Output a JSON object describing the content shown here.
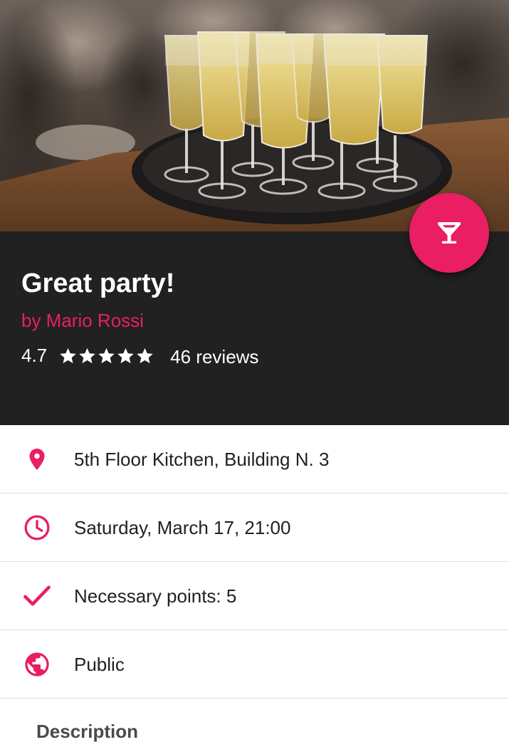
{
  "event": {
    "title": "Great party!",
    "author": "by Mario Rossi",
    "rating": "4.7",
    "stars": 5,
    "reviews": "46 reviews"
  },
  "fab": {
    "icon": "cocktail-icon"
  },
  "details": {
    "location": {
      "icon": "location-pin-icon",
      "text": "5th Floor Kitchen, Building N. 3"
    },
    "datetime": {
      "icon": "clock-icon",
      "text": "Saturday, March 17, 21:00"
    },
    "points": {
      "icon": "check-icon",
      "text": "Necessary points: 5"
    },
    "visibility": {
      "icon": "globe-icon",
      "text": "Public"
    }
  },
  "description": {
    "heading": "Description"
  },
  "colors": {
    "accent": "#e91e63",
    "header_bg": "#212121",
    "text": "#212121",
    "divider": "#dddddd"
  }
}
